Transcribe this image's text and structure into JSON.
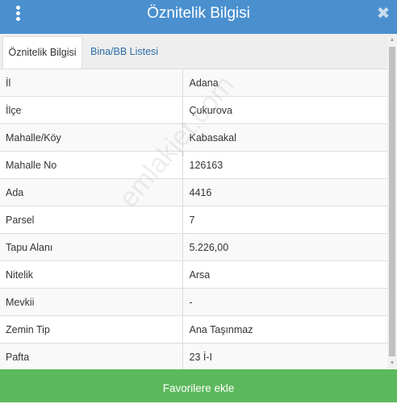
{
  "header": {
    "title": "Öznitelik Bilgisi",
    "menu_icon": "vertical-dots-icon",
    "close_icon": "close-icon",
    "close_glyph": "✖"
  },
  "tabs": [
    {
      "label": "Öznitelik Bilgisi",
      "active": true
    },
    {
      "label": "Bina/BB Listesi",
      "active": false
    }
  ],
  "rows": [
    {
      "key": "İl",
      "value": "Adana"
    },
    {
      "key": "İlçe",
      "value": "Çukurova"
    },
    {
      "key": "Mahalle/Köy",
      "value": "Kabasakal"
    },
    {
      "key": "Mahalle No",
      "value": "126163"
    },
    {
      "key": "Ada",
      "value": "4416"
    },
    {
      "key": "Parsel",
      "value": "7"
    },
    {
      "key": "Tapu Alanı",
      "value": "5.226,00"
    },
    {
      "key": "Nitelik",
      "value": "Arsa"
    },
    {
      "key": "Mevkii",
      "value": "-"
    },
    {
      "key": "Zemin Tip",
      "value": "Ana Taşınmaz"
    },
    {
      "key": "Pafta",
      "value": "23 İ-I"
    }
  ],
  "footer": {
    "button_label": "Favorilere ekle"
  },
  "watermark": "emlakjet.com",
  "colors": {
    "header": "#4a90cf",
    "footer_button": "#5cb85c",
    "tab_link": "#2d6ea8"
  }
}
